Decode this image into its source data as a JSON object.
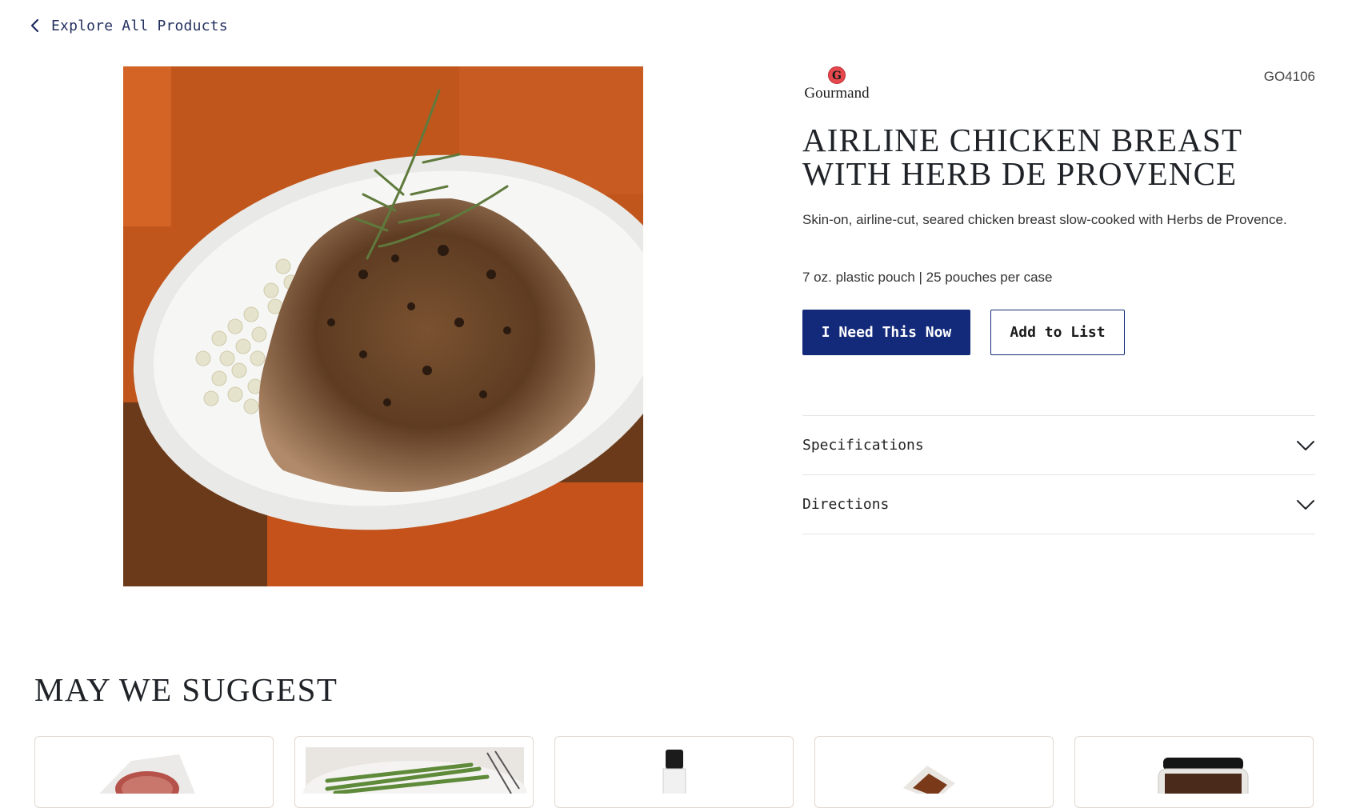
{
  "nav": {
    "back_label": "Explore All Products",
    "back_icon": "chevron-left-icon"
  },
  "product": {
    "brand_name": "Gourmand",
    "brand_initial": "G",
    "sku": "GO4106",
    "title": "Airline Chicken Breast with Herb de Provence",
    "description": "Skin-on, airline-cut, seared chicken breast slow-cooked with Herbs de Provence.",
    "packaging": "7 oz. plastic pouch | 25 pouches per case",
    "image": "plated-chicken-breast-with-pearl-couscous"
  },
  "actions": {
    "primary_label": "I Need This Now",
    "secondary_label": "Add to List"
  },
  "accordion": [
    {
      "label": "Specifications",
      "icon": "chevron-down-icon"
    },
    {
      "label": "Directions",
      "icon": "chevron-down-icon"
    }
  ],
  "suggestions": {
    "title": "MAY WE SUGGEST",
    "cards": [
      {
        "image": "sliced-meat-package"
      },
      {
        "image": "asparagus-plate"
      },
      {
        "image": "glass-bottle"
      },
      {
        "image": "sauce-pouch"
      },
      {
        "image": "jar-of-dark-pieces"
      }
    ]
  },
  "colors": {
    "primary": "#13297a",
    "link": "#23305e",
    "brand_red": "#e5484d",
    "divider": "#e3e3e3"
  }
}
